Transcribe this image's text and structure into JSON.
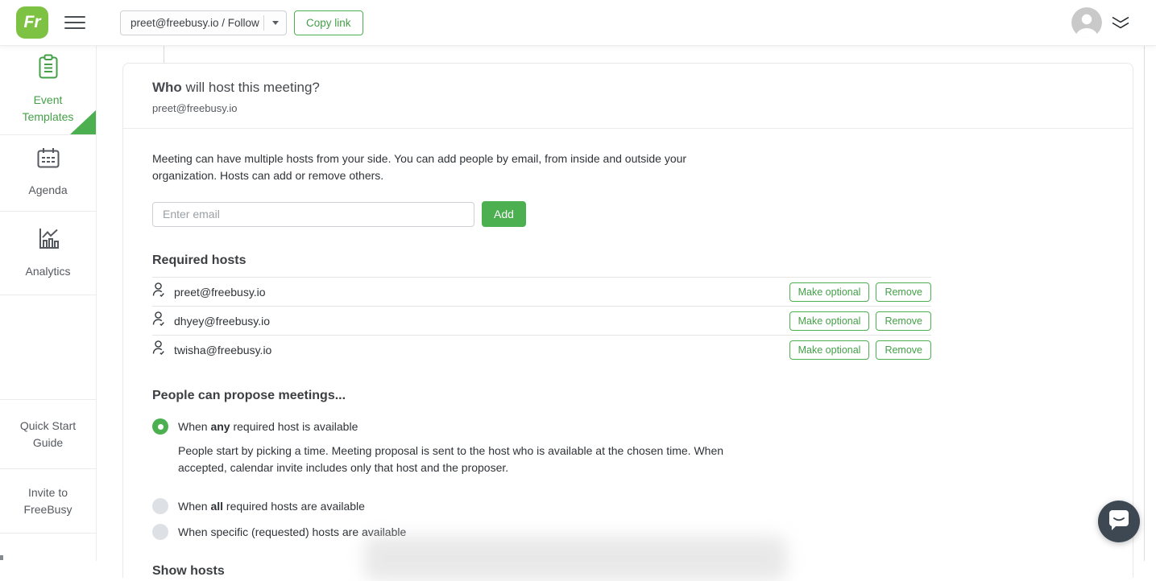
{
  "topbar": {
    "logo_text": "Fr",
    "template_selector_value": "preet@freebusy.io / Follow",
    "copy_link_label": "Copy link"
  },
  "sidebar": {
    "items": [
      {
        "label": "Event Templates",
        "icon": "clipboard-icon",
        "active": true
      },
      {
        "label": "Agenda",
        "icon": "calendar-icon",
        "active": false
      },
      {
        "label": "Analytics",
        "icon": "bar-chart-icon",
        "active": false
      }
    ],
    "footer_items": [
      {
        "label": "Quick Start Guide"
      },
      {
        "label": "Invite to FreeBusy"
      }
    ]
  },
  "card": {
    "header": {
      "title_bold": "Who",
      "title_rest": " will host this meeting?",
      "subtitle": "preet@freebusy.io"
    },
    "description": "Meeting can have multiple hosts from your side. You can add people by email, from inside and outside your organization. Hosts can add or remove others.",
    "email_input_placeholder": "Enter email",
    "add_button_label": "Add",
    "required_hosts": {
      "title": "Required hosts",
      "make_optional_label": "Make optional",
      "remove_label": "Remove",
      "rows": [
        {
          "email": "preet@freebusy.io",
          "icon": "user-check-icon"
        },
        {
          "email": "dhyey@freebusy.io",
          "icon": "user-check-icon"
        },
        {
          "email": "twisha@freebusy.io",
          "icon": "user-check-icon"
        }
      ]
    },
    "propose": {
      "title": "People can propose meetings...",
      "options": [
        {
          "pre": "When ",
          "bold": "any",
          "post": " required host is available",
          "selected": true,
          "description": "People start by picking a time. Meeting proposal is sent to the host who is available at the chosen time. When accepted, calendar invite includes only that host and the proposer."
        },
        {
          "pre": "When ",
          "bold": "all",
          "post": " required hosts are available",
          "selected": false
        },
        {
          "pre": "When specific (requested) hosts are available",
          "bold": "",
          "post": "",
          "selected": false
        }
      ]
    },
    "show_hosts_title": "Show hosts"
  },
  "colors": {
    "primary_green": "#4caf50",
    "green_text": "#43a047",
    "logo_green": "#7dc243",
    "chat_fab_bg": "#3e4852",
    "unselected_radio": "#dde1e6"
  }
}
